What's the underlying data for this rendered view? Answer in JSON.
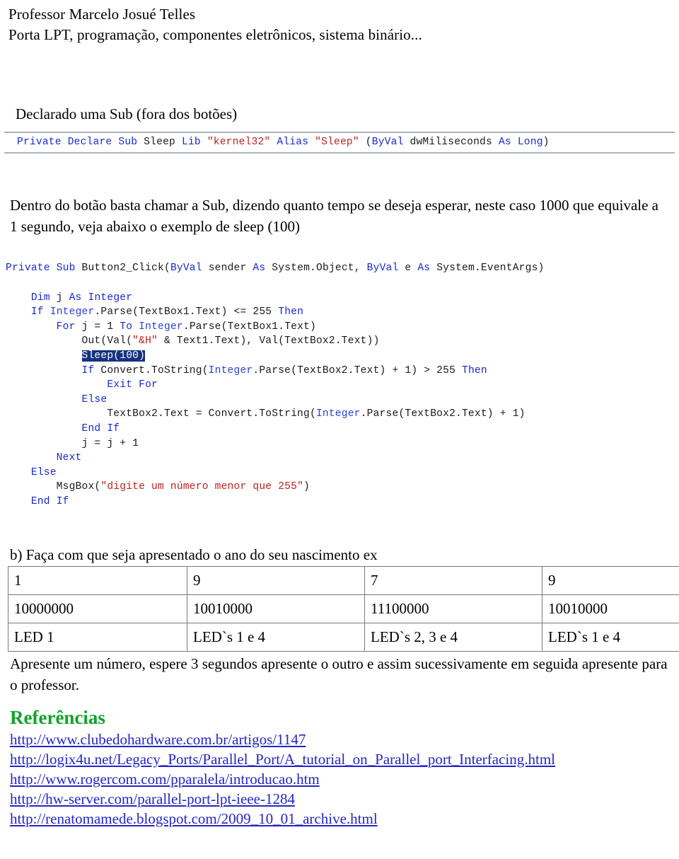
{
  "header": {
    "line1": "Professor Marcelo Josué Telles",
    "line2": "Porta LPT, programação, componentes eletrônicos, sistema binário..."
  },
  "section_declare": {
    "intro": "Declarado uma Sub (fora dos botões)",
    "code_line": "Private Declare Sub Sleep Lib \"kernel32\" Alias \"Sleep\" (ByVal dwMiliseconds As Long)",
    "code_tokens": [
      {
        "t": "Private",
        "c": "kw"
      },
      {
        "t": " ",
        "c": "pln"
      },
      {
        "t": "Declare",
        "c": "kw"
      },
      {
        "t": " ",
        "c": "pln"
      },
      {
        "t": "Sub",
        "c": "kw"
      },
      {
        "t": " Sleep ",
        "c": "pln"
      },
      {
        "t": "Lib",
        "c": "kw"
      },
      {
        "t": " ",
        "c": "pln"
      },
      {
        "t": "\"kernel32\"",
        "c": "str"
      },
      {
        "t": " ",
        "c": "pln"
      },
      {
        "t": "Alias",
        "c": "kw"
      },
      {
        "t": " ",
        "c": "pln"
      },
      {
        "t": "\"Sleep\"",
        "c": "str"
      },
      {
        "t": " (",
        "c": "pln"
      },
      {
        "t": "ByVal",
        "c": "kw"
      },
      {
        "t": " dwMiliseconds ",
        "c": "pln"
      },
      {
        "t": "As",
        "c": "kw"
      },
      {
        "t": " ",
        "c": "pln"
      },
      {
        "t": "Long",
        "c": "kw"
      },
      {
        "t": ")",
        "c": "pln"
      }
    ]
  },
  "section_sleep": {
    "paragraph": "Dentro do botão basta chamar a Sub, dizendo quanto tempo se deseja esperar, neste caso 1000 que equivale a 1 segundo, veja abaixo o exemplo de sleep (100)"
  },
  "code_block": {
    "lines": [
      {
        "indent": 0,
        "tokens": [
          {
            "t": "Private",
            "c": "kw"
          },
          {
            "t": " ",
            "c": "pln"
          },
          {
            "t": "Sub",
            "c": "kw"
          },
          {
            "t": " Button2_Click(",
            "c": "pln"
          },
          {
            "t": "ByVal",
            "c": "kw"
          },
          {
            "t": " sender ",
            "c": "pln"
          },
          {
            "t": "As",
            "c": "kw"
          },
          {
            "t": " System.Object, ",
            "c": "pln"
          },
          {
            "t": "ByVal",
            "c": "kw"
          },
          {
            "t": " e ",
            "c": "pln"
          },
          {
            "t": "As",
            "c": "kw"
          },
          {
            "t": " System.EventArgs)",
            "c": "pln"
          }
        ]
      },
      {
        "indent": 0,
        "tokens": []
      },
      {
        "indent": 1,
        "tokens": [
          {
            "t": "Dim",
            "c": "kw"
          },
          {
            "t": " j ",
            "c": "pln"
          },
          {
            "t": "As",
            "c": "kw"
          },
          {
            "t": " ",
            "c": "pln"
          },
          {
            "t": "Integer",
            "c": "kw"
          }
        ]
      },
      {
        "indent": 1,
        "tokens": [
          {
            "t": "If",
            "c": "kw"
          },
          {
            "t": " ",
            "c": "pln"
          },
          {
            "t": "Integer",
            "c": "typ"
          },
          {
            "t": ".Parse(TextBox1.Text) <= 255 ",
            "c": "pln"
          },
          {
            "t": "Then",
            "c": "kw"
          }
        ]
      },
      {
        "indent": 2,
        "tokens": [
          {
            "t": "For",
            "c": "kw"
          },
          {
            "t": " j = 1 ",
            "c": "pln"
          },
          {
            "t": "To",
            "c": "kw"
          },
          {
            "t": " ",
            "c": "pln"
          },
          {
            "t": "Integer",
            "c": "typ"
          },
          {
            "t": ".Parse(TextBox1.Text)",
            "c": "pln"
          }
        ]
      },
      {
        "indent": 3,
        "tokens": [
          {
            "t": "Out(Val(",
            "c": "pln"
          },
          {
            "t": "\"&H\"",
            "c": "str"
          },
          {
            "t": " & Text1.Text), Val(TextBox2.Text))",
            "c": "pln"
          }
        ]
      },
      {
        "indent": 3,
        "tokens": [
          {
            "t": "Sleep(100)",
            "c": "sel"
          }
        ]
      },
      {
        "indent": 3,
        "tokens": [
          {
            "t": "If",
            "c": "kw"
          },
          {
            "t": " Convert.ToString(",
            "c": "pln"
          },
          {
            "t": "Integer",
            "c": "typ"
          },
          {
            "t": ".Parse(TextBox2.Text) + 1) > 255 ",
            "c": "pln"
          },
          {
            "t": "Then",
            "c": "kw"
          }
        ]
      },
      {
        "indent": 4,
        "tokens": [
          {
            "t": "Exit",
            "c": "kw"
          },
          {
            "t": " ",
            "c": "pln"
          },
          {
            "t": "For",
            "c": "kw"
          }
        ]
      },
      {
        "indent": 3,
        "tokens": [
          {
            "t": "Else",
            "c": "kw"
          }
        ]
      },
      {
        "indent": 4,
        "tokens": [
          {
            "t": "TextBox2.Text = Convert.ToString(",
            "c": "pln"
          },
          {
            "t": "Integer",
            "c": "typ"
          },
          {
            "t": ".Parse(TextBox2.Text) + 1)",
            "c": "pln"
          }
        ]
      },
      {
        "indent": 3,
        "tokens": [
          {
            "t": "End",
            "c": "kw"
          },
          {
            "t": " ",
            "c": "pln"
          },
          {
            "t": "If",
            "c": "kw"
          }
        ]
      },
      {
        "indent": 3,
        "tokens": [
          {
            "t": "j = j + 1",
            "c": "pln"
          }
        ]
      },
      {
        "indent": 2,
        "tokens": [
          {
            "t": "Next",
            "c": "kw"
          }
        ]
      },
      {
        "indent": 1,
        "tokens": [
          {
            "t": "Else",
            "c": "kw"
          }
        ]
      },
      {
        "indent": 2,
        "tokens": [
          {
            "t": "MsgBox(",
            "c": "pln"
          },
          {
            "t": "\"digite um número menor que 255\"",
            "c": "str"
          },
          {
            "t": ")",
            "c": "pln"
          }
        ]
      },
      {
        "indent": 1,
        "tokens": [
          {
            "t": "End",
            "c": "kw"
          },
          {
            "t": " ",
            "c": "pln"
          },
          {
            "t": "If",
            "c": "kw"
          }
        ]
      }
    ]
  },
  "exercise": {
    "label": "b) Faça com que seja apresentado o ano do seu nascimento ex",
    "table": {
      "rows": [
        [
          "1",
          "9",
          "7",
          "9"
        ],
        [
          "10000000",
          "10010000",
          "11100000",
          "10010000"
        ],
        [
          "LED 1",
          "LED`s 1 e 4",
          "LED`s 2, 3 e 4",
          "LED`s 1 e 4"
        ]
      ]
    },
    "note": "Apresente um número, espere 3 segundos apresente o outro e assim sucessivamente em seguida apresente para o professor."
  },
  "references": {
    "title": "Referências",
    "links": [
      "http://www.clubedohardware.com.br/artigos/1147",
      "http://logix4u.net/Legacy_Ports/Parallel_Port/A_tutorial_on_Parallel_port_Interfacing.html",
      "http://www.rogercom.com/pparalela/introducao.htm",
      "http://hw-server.com/parallel-port-lpt-ieee-1284",
      "http://renatomamede.blogspot.com/2009_10_01_archive.html"
    ]
  },
  "colors": {
    "keyword": "#1a28cf",
    "string": "#bb2222",
    "selection_bg": "#16317f",
    "reference_title": "#11a32b",
    "link": "#2424c8",
    "table_border": "#7b7b7b"
  }
}
